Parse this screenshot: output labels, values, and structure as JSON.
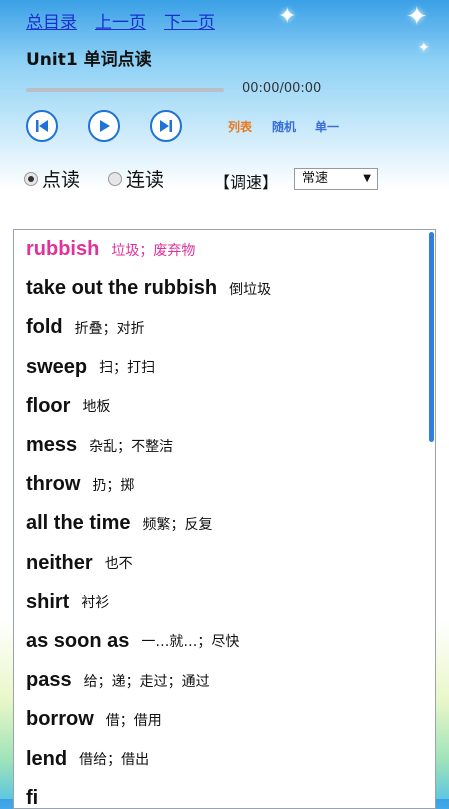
{
  "nav": {
    "contents": "总目录",
    "prev": "上一页",
    "next": "下一页"
  },
  "title": "Unit1 单词点读",
  "player": {
    "time": "00:00/00:00",
    "progress": 0,
    "modes": [
      "列表",
      "随机",
      "单一"
    ],
    "mode_colors": [
      "#e87a1e",
      "#3a6fd8",
      "#3a6fd8"
    ]
  },
  "read_modes": {
    "point": "点读",
    "continuous": "连读",
    "selected": "point"
  },
  "speed": {
    "label": "【调速】",
    "value": "常速"
  },
  "words": [
    {
      "word": "rubbish",
      "meaning": "垃圾；废弃物",
      "active": true
    },
    {
      "word": "take out the rubbish",
      "meaning": "倒垃圾"
    },
    {
      "word": "fold",
      "meaning": "折叠；对折"
    },
    {
      "word": "sweep",
      "meaning": "扫；打扫"
    },
    {
      "word": "floor",
      "meaning": "地板"
    },
    {
      "word": "mess",
      "meaning": "杂乱；不整洁"
    },
    {
      "word": "throw",
      "meaning": "扔；掷"
    },
    {
      "word": "all the time",
      "meaning": "频繁；反复"
    },
    {
      "word": "neither",
      "meaning": "也不"
    },
    {
      "word": "shirt",
      "meaning": "衬衫"
    },
    {
      "word": "as soon as",
      "meaning": "一…就…；尽快"
    },
    {
      "word": "pass",
      "meaning": "给；递；走过；通过"
    },
    {
      "word": "borrow",
      "meaning": "借；借用"
    },
    {
      "word": "lend",
      "meaning": "借给；借出"
    },
    {
      "word": "fi",
      "meaning": ""
    }
  ],
  "accent_color": "#e0329a"
}
